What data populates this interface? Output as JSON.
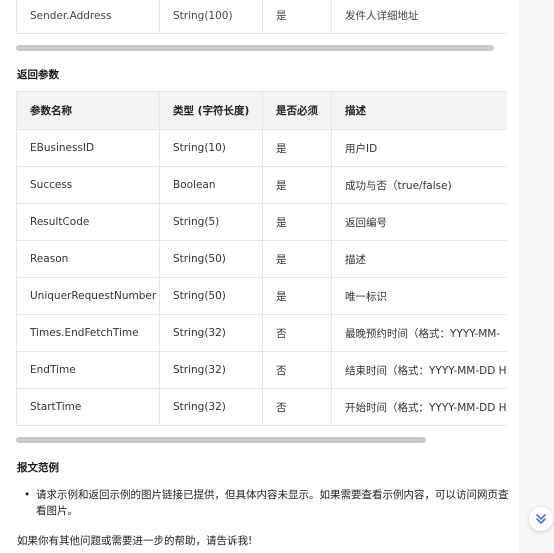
{
  "top_table": {
    "row": [
      "Sender.Address",
      "String(100)",
      "是",
      "发件人详细地址"
    ]
  },
  "return_params": {
    "title": "返回参数",
    "headers": [
      "参数名称",
      "类型 (字符长度)",
      "是否必须",
      "描述"
    ],
    "rows": [
      [
        "EBusinessID",
        "String(10)",
        "是",
        "用户ID"
      ],
      [
        "Success",
        "Boolean",
        "是",
        "成功与否（true/false)"
      ],
      [
        "ResultCode",
        "String(5)",
        "是",
        "返回编号"
      ],
      [
        "Reason",
        "String(50)",
        "是",
        "描述"
      ],
      [
        "UniquerRequestNumber",
        "String(50)",
        "是",
        "唯一标识"
      ],
      [
        "Times.EndFetchTime",
        "String(32)",
        "否",
        "最晚预约时间（格式：YYYY-MM-"
      ],
      [
        "EndTime",
        "String(32)",
        "否",
        "结束时间（格式：YYYY-MM-DD H"
      ],
      [
        "StartTime",
        "String(32)",
        "否",
        "开始时间（格式：YYYY-MM-DD H"
      ]
    ]
  },
  "examples": {
    "title": "报文范例",
    "bullet": "请求示例和返回示例的图片链接已提供，但具体内容未显示。如果需要查看示例内容，可以访问网页查看图片。"
  },
  "closing": "如果你有其他问题或需要进一步的帮助，请告诉我!",
  "icons": {
    "scroll_down": "double-chevron-down-icon"
  },
  "colors": {
    "accent": "#4a6cf7",
    "header_bg": "#f3f3f4",
    "border": "#e6e6e6"
  }
}
